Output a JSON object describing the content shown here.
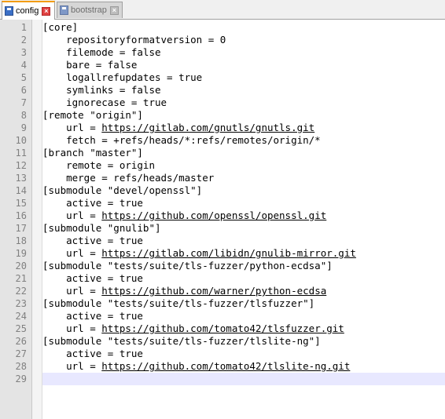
{
  "tabs": [
    {
      "label": "config",
      "active": true
    },
    {
      "label": "bootstrap",
      "active": false
    }
  ],
  "close_glyph": "×",
  "lines": [
    {
      "n": "1",
      "pre": "[core]",
      "url": "",
      "post": ""
    },
    {
      "n": "2",
      "pre": "    repositoryformatversion = 0",
      "url": "",
      "post": ""
    },
    {
      "n": "3",
      "pre": "    filemode = false",
      "url": "",
      "post": ""
    },
    {
      "n": "4",
      "pre": "    bare = false",
      "url": "",
      "post": ""
    },
    {
      "n": "5",
      "pre": "    logallrefupdates = true",
      "url": "",
      "post": ""
    },
    {
      "n": "6",
      "pre": "    symlinks = false",
      "url": "",
      "post": ""
    },
    {
      "n": "7",
      "pre": "    ignorecase = true",
      "url": "",
      "post": ""
    },
    {
      "n": "8",
      "pre": "[remote \"origin\"]",
      "url": "",
      "post": ""
    },
    {
      "n": "9",
      "pre": "    url = ",
      "url": "https://gitlab.com/gnutls/gnutls.git",
      "post": ""
    },
    {
      "n": "10",
      "pre": "    fetch = +refs/heads/*:refs/remotes/origin/*",
      "url": "",
      "post": ""
    },
    {
      "n": "11",
      "pre": "[branch \"master\"]",
      "url": "",
      "post": ""
    },
    {
      "n": "12",
      "pre": "    remote = origin",
      "url": "",
      "post": ""
    },
    {
      "n": "13",
      "pre": "    merge = refs/heads/master",
      "url": "",
      "post": ""
    },
    {
      "n": "14",
      "pre": "[submodule \"devel/openssl\"]",
      "url": "",
      "post": ""
    },
    {
      "n": "15",
      "pre": "    active = true",
      "url": "",
      "post": ""
    },
    {
      "n": "16",
      "pre": "    url = ",
      "url": "https://github.com/openssl/openssl.git",
      "post": ""
    },
    {
      "n": "17",
      "pre": "[submodule \"gnulib\"]",
      "url": "",
      "post": ""
    },
    {
      "n": "18",
      "pre": "    active = true",
      "url": "",
      "post": ""
    },
    {
      "n": "19",
      "pre": "    url = ",
      "url": "https://gitlab.com/libidn/gnulib-mirror.git",
      "post": ""
    },
    {
      "n": "20",
      "pre": "[submodule \"tests/suite/tls-fuzzer/python-ecdsa\"]",
      "url": "",
      "post": ""
    },
    {
      "n": "21",
      "pre": "    active = true",
      "url": "",
      "post": ""
    },
    {
      "n": "22",
      "pre": "    url = ",
      "url": "https://github.com/warner/python-ecdsa",
      "post": ""
    },
    {
      "n": "23",
      "pre": "[submodule \"tests/suite/tls-fuzzer/tlsfuzzer\"]",
      "url": "",
      "post": ""
    },
    {
      "n": "24",
      "pre": "    active = true",
      "url": "",
      "post": ""
    },
    {
      "n": "25",
      "pre": "    url = ",
      "url": "https://github.com/tomato42/tlsfuzzer.git",
      "post": ""
    },
    {
      "n": "26",
      "pre": "[submodule \"tests/suite/tls-fuzzer/tlslite-ng\"]",
      "url": "",
      "post": ""
    },
    {
      "n": "27",
      "pre": "    active = true",
      "url": "",
      "post": ""
    },
    {
      "n": "28",
      "pre": "    url = ",
      "url": "https://github.com/tomato42/tlslite-ng.git",
      "post": ""
    },
    {
      "n": "29",
      "pre": "",
      "url": "",
      "post": ""
    }
  ],
  "current_line": 29,
  "colors": {
    "active_tab_accent": "#f39c12",
    "current_line_bg": "#e8e8ff",
    "gutter_bg": "#e4e4e4"
  }
}
